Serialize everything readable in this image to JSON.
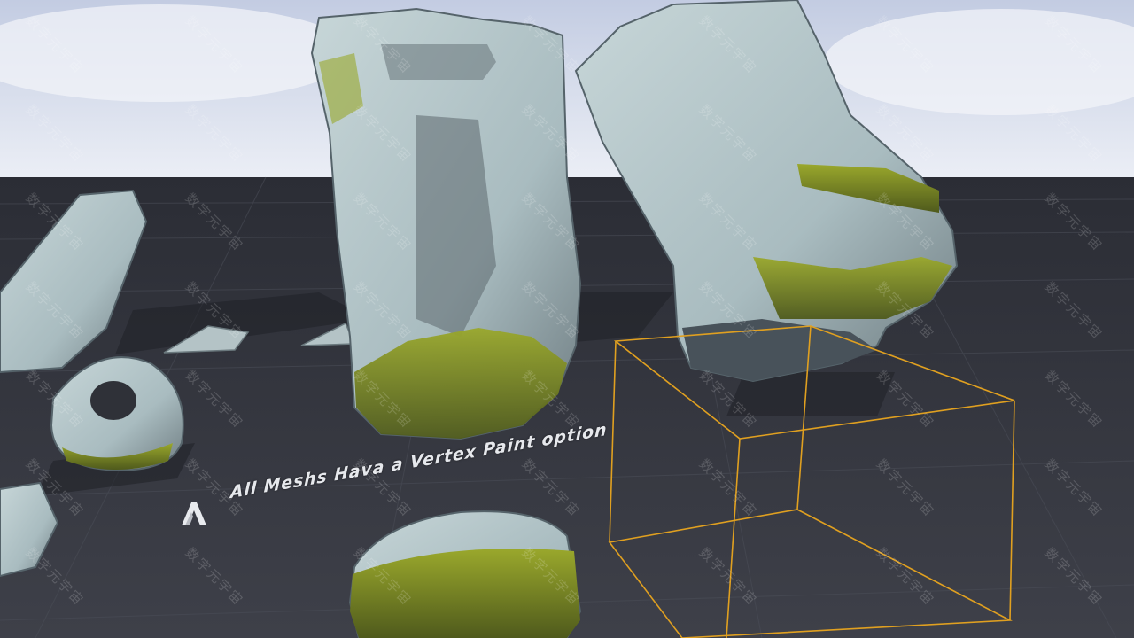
{
  "scene": {
    "label_text": "All Meshs Hava a Vertex Paint option",
    "watermark_text": "数字元宇宙",
    "colors": {
      "sky_top": "#c9d2e6",
      "sky_bottom": "#e7ebf4",
      "floor": "#34363e",
      "rock": "#b7c9cc",
      "rock_shadow": "#5f6d72",
      "moss": "#a6b32a",
      "bounds_box": "#e0a020"
    },
    "icons": [
      "unreal-logo-icon"
    ]
  }
}
